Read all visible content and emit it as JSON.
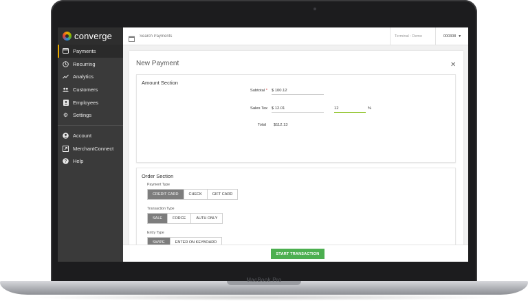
{
  "device": {
    "brand": "MacBook Pro"
  },
  "app": {
    "logo_text": "converge"
  },
  "sidebar": {
    "items": [
      {
        "label": "Payments",
        "icon": "card-icon",
        "active": true
      },
      {
        "label": "Recurring",
        "icon": "clock-icon"
      },
      {
        "label": "Analytics",
        "icon": "trend-icon"
      },
      {
        "label": "Customers",
        "icon": "people-icon"
      },
      {
        "label": "Employees",
        "icon": "badge-icon"
      },
      {
        "label": "Settings",
        "icon": "gear-icon"
      }
    ],
    "secondary": [
      {
        "label": "Account",
        "icon": "account-icon"
      },
      {
        "label": "MerchantConnect",
        "icon": "external-link-icon"
      },
      {
        "label": "Help",
        "icon": "help-icon"
      }
    ]
  },
  "topbar": {
    "search_placeholder": "Search Payments",
    "terminal": "Terminal : Demo",
    "account": "000308"
  },
  "payment": {
    "title": "New Payment",
    "amount_section": {
      "title": "Amount Section",
      "subtotal_label": "Subtotal",
      "required_mark": "*",
      "subtotal_value": "$ 100.12",
      "sales_tax_label": "Sales Tax",
      "sales_tax_value": "$ 12.01",
      "tax_rate_value": "12",
      "percent_sign": "%",
      "total_label": "Total",
      "total_value": "$112.13"
    },
    "order_section": {
      "title": "Order Section",
      "payment_type_label": "Payment Type",
      "payment_types": [
        "CREDIT CARD",
        "CHECK",
        "GIFT CARD"
      ],
      "transaction_type_label": "Transaction Type",
      "transaction_types": [
        "SALE",
        "FORCE",
        "AUTH ONLY"
      ],
      "entry_type_label": "Entry Type",
      "entry_types": [
        "SWIPE",
        "ENTER ON KEYBOARD"
      ]
    }
  },
  "footer": {
    "start_label": "START TRANSACTION"
  },
  "colors": {
    "accent": "#4caf50",
    "sidebar": "#3a3a3a",
    "selected": "#7d7d7d",
    "active_marker": "#e8a700"
  }
}
